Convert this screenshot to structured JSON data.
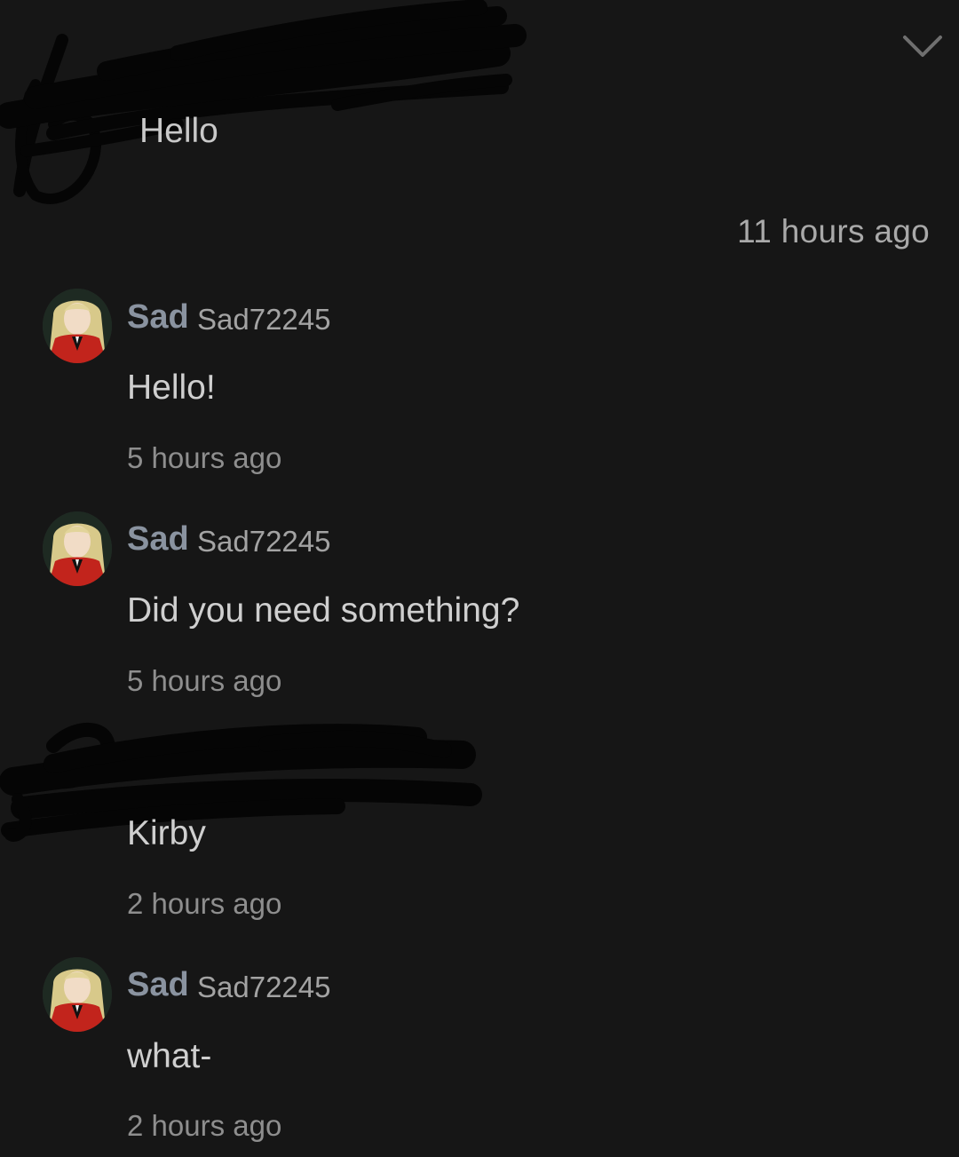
{
  "thread": {
    "collapse_icon": "chevron-down-icon",
    "messages": [
      {
        "author": "self",
        "name_redacted": true,
        "text": "Hello",
        "time": "11 hours ago"
      },
      {
        "author": "other",
        "display_name": "Sad",
        "username": "Sad72245",
        "avatar_icon": "avatar-anime-girl",
        "text": "Hello!",
        "time": "5 hours ago"
      },
      {
        "author": "other",
        "display_name": "Sad",
        "username": "Sad72245",
        "avatar_icon": "avatar-anime-girl",
        "text": "Did you need something?",
        "time": "5 hours ago"
      },
      {
        "author": "self",
        "name_redacted": true,
        "text": "Kirby",
        "time": "2 hours ago"
      },
      {
        "author": "other",
        "display_name": "Sad",
        "username": "Sad72245",
        "avatar_icon": "avatar-anime-girl",
        "text": "what-",
        "time": "2 hours ago"
      }
    ]
  },
  "colors": {
    "background": "#161616",
    "display_name": "#8a93a0",
    "text": "#cfcfcf",
    "timestamp": "#8e8e8e"
  }
}
